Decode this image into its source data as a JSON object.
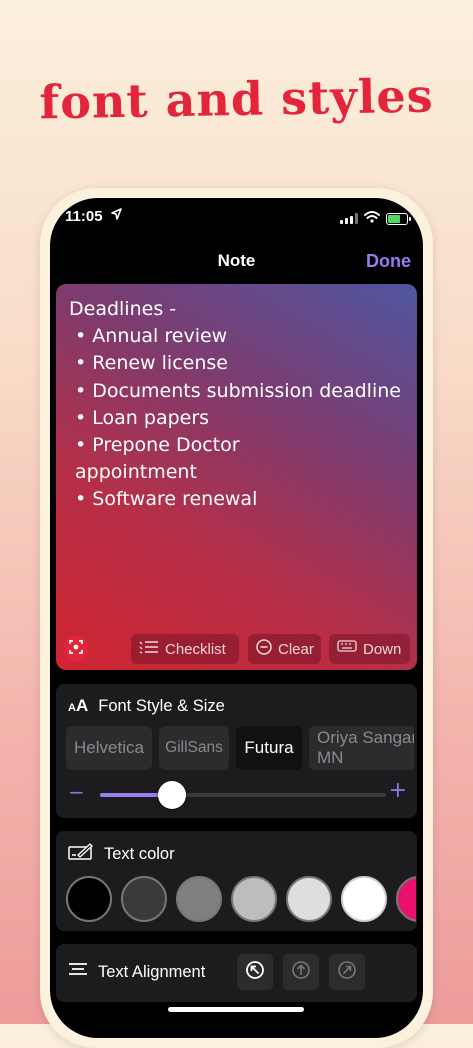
{
  "headline": "font and styles",
  "status_bar": {
    "time": "11:05",
    "icons": [
      "location-arrow-icon",
      "cellular-signal-icon",
      "wifi-icon",
      "battery-charging-icon"
    ]
  },
  "nav": {
    "title": "Note",
    "done_label": "Done"
  },
  "note": {
    "text": "Deadlines -\n • Annual review\n • Renew license\n • Documents submission deadline\n • Loan papers\n • Prepone Doctor\n appointment\n • Software renewal",
    "toolbar": {
      "checklist_label": "Checklist",
      "clear_label": "Clear",
      "down_label": "Down"
    }
  },
  "font_panel": {
    "title": "Font Style & Size",
    "fonts": [
      "Helvetica",
      "GillSans",
      "Futura",
      "Oriya Sangam MN"
    ],
    "selected_font": "Futura",
    "size_fraction": 0.25,
    "minus_label": "−",
    "plus_label": "+"
  },
  "color_panel": {
    "title": "Text color",
    "colors": [
      "#000000",
      "#3a3a3a",
      "#7f7f7f",
      "#bdbdbd",
      "#dedede",
      "#ffffff",
      "#e8126e"
    ]
  },
  "align_panel": {
    "title": "Text Alignment",
    "options": [
      "align-top-left-icon",
      "align-top-icon",
      "align-top-right-icon"
    ],
    "selected": 0
  },
  "colors": {
    "accent": "#9b7bf2",
    "headline": "#e2253a"
  }
}
